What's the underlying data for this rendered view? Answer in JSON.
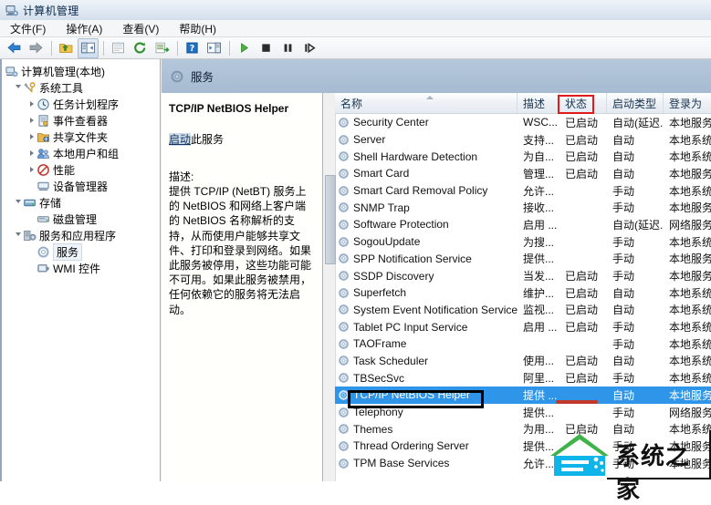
{
  "window": {
    "title": "计算机管理",
    "icon": "computer-management-icon"
  },
  "menu": {
    "items": [
      {
        "label": "文件(F)",
        "name": "menu-file"
      },
      {
        "label": "操作(A)",
        "name": "menu-action"
      },
      {
        "label": "查看(V)",
        "name": "menu-view"
      },
      {
        "label": "帮助(H)",
        "name": "menu-help"
      }
    ]
  },
  "toolbar": {
    "buttons": [
      {
        "name": "back-icon",
        "glyph": "back-arrow"
      },
      {
        "name": "forward-icon",
        "glyph": "forward-arrow"
      },
      {
        "name": "up-folder-icon",
        "glyph": "up-folder"
      },
      {
        "name": "show-hide-console-tree-icon",
        "glyph": "console-tree"
      },
      {
        "name": "properties-icon",
        "glyph": "properties"
      },
      {
        "name": "refresh-icon",
        "glyph": "refresh"
      },
      {
        "name": "export-list-icon",
        "glyph": "export-list"
      },
      {
        "name": "help-icon",
        "glyph": "question-mark"
      },
      {
        "name": "show-action-pane-icon",
        "glyph": "action-pane"
      },
      {
        "name": "start-service-icon",
        "glyph": "play"
      },
      {
        "name": "stop-service-icon",
        "glyph": "stop"
      },
      {
        "name": "pause-service-icon",
        "glyph": "pause"
      },
      {
        "name": "restart-service-icon",
        "glyph": "restart"
      }
    ]
  },
  "tree": {
    "root": {
      "label": "计算机管理(本地)",
      "icon": "computer-icon"
    },
    "items": [
      {
        "label": "系统工具",
        "icon": "system-tools-icon",
        "depth": 1,
        "expander": "open",
        "name": "sidebar-item-system-tools"
      },
      {
        "label": "任务计划程序",
        "icon": "task-scheduler-icon",
        "depth": 2,
        "expander": "closed",
        "name": "sidebar-item-task-scheduler"
      },
      {
        "label": "事件查看器",
        "icon": "event-viewer-icon",
        "depth": 2,
        "expander": "closed",
        "name": "sidebar-item-event-viewer"
      },
      {
        "label": "共享文件夹",
        "icon": "shared-folders-icon",
        "depth": 2,
        "expander": "closed",
        "name": "sidebar-item-shared-folders"
      },
      {
        "label": "本地用户和组",
        "icon": "local-users-groups-icon",
        "depth": 2,
        "expander": "closed",
        "name": "sidebar-item-local-users-groups"
      },
      {
        "label": "性能",
        "icon": "performance-icon",
        "depth": 2,
        "expander": "closed",
        "name": "sidebar-item-performance"
      },
      {
        "label": "设备管理器",
        "icon": "device-manager-icon",
        "depth": 2,
        "expander": "none",
        "name": "sidebar-item-device-manager"
      },
      {
        "label": "存储",
        "icon": "storage-icon",
        "depth": 1,
        "expander": "open",
        "name": "sidebar-item-storage"
      },
      {
        "label": "磁盘管理",
        "icon": "disk-management-icon",
        "depth": 2,
        "expander": "none",
        "name": "sidebar-item-disk-management"
      },
      {
        "label": "服务和应用程序",
        "icon": "services-applications-icon",
        "depth": 1,
        "expander": "open",
        "name": "sidebar-item-services-applications"
      },
      {
        "label": "服务",
        "icon": "services-icon",
        "depth": 2,
        "expander": "none",
        "selected": true,
        "name": "sidebar-item-services"
      },
      {
        "label": "WMI 控件",
        "icon": "wmi-control-icon",
        "depth": 2,
        "expander": "none",
        "name": "sidebar-item-wmi-control"
      }
    ]
  },
  "right_header": {
    "title": "服务",
    "icon": "services-icon"
  },
  "detail": {
    "service_name": "TCP/IP NetBIOS Helper",
    "action_link": "启动",
    "action_suffix": "此服务",
    "description_label": "描述:",
    "description": "提供 TCP/IP (NetBT) 服务上的 NetBIOS 和网络上客户端的 NetBIOS 名称解析的支持，从而使用户能够共享文件、打印和登录到网络。如果此服务被停用，这些功能可能不可用。如果此服务被禁用，任何依赖它的服务将无法启动。"
  },
  "list": {
    "columns": [
      {
        "label": "名称",
        "name": "column-header-name",
        "sorted": true
      },
      {
        "label": "描述",
        "name": "column-header-description"
      },
      {
        "label": "状态",
        "name": "column-header-status",
        "highlighted": true
      },
      {
        "label": "启动类型",
        "name": "column-header-startup-type"
      },
      {
        "label": "登录为",
        "name": "column-header-log-on-as"
      }
    ],
    "rows": [
      {
        "name": "Security Center",
        "desc": "WSC...",
        "state": "已启动",
        "start": "自动(延迟...",
        "logon": "本地服务"
      },
      {
        "name": "Server",
        "desc": "支持...",
        "state": "已启动",
        "start": "自动",
        "logon": "本地系统"
      },
      {
        "name": "Shell Hardware Detection",
        "desc": "为自...",
        "state": "已启动",
        "start": "自动",
        "logon": "本地系统"
      },
      {
        "name": "Smart Card",
        "desc": "管理...",
        "state": "已启动",
        "start": "自动",
        "logon": "本地服务"
      },
      {
        "name": "Smart Card Removal Policy",
        "desc": "允许...",
        "state": "",
        "start": "手动",
        "logon": "本地系统"
      },
      {
        "name": "SNMP Trap",
        "desc": "接收...",
        "state": "",
        "start": "手动",
        "logon": "本地服务"
      },
      {
        "name": "Software Protection",
        "desc": "启用 ...",
        "state": "",
        "start": "自动(延迟...",
        "logon": "网络服务"
      },
      {
        "name": "SogouUpdate",
        "desc": "为搜...",
        "state": "",
        "start": "手动",
        "logon": "本地系统"
      },
      {
        "name": "SPP Notification Service",
        "desc": "提供...",
        "state": "",
        "start": "手动",
        "logon": "本地服务"
      },
      {
        "name": "SSDP Discovery",
        "desc": "当发...",
        "state": "已启动",
        "start": "手动",
        "logon": "本地服务"
      },
      {
        "name": "Superfetch",
        "desc": "维护...",
        "state": "已启动",
        "start": "自动",
        "logon": "本地系统"
      },
      {
        "name": "System Event Notification Service",
        "desc": "监视...",
        "state": "已启动",
        "start": "自动",
        "logon": "本地系统"
      },
      {
        "name": "Tablet PC Input Service",
        "desc": "启用 ...",
        "state": "已启动",
        "start": "手动",
        "logon": "本地系统"
      },
      {
        "name": "TAOFrame",
        "desc": "",
        "state": "",
        "start": "手动",
        "logon": "本地系统"
      },
      {
        "name": "Task Scheduler",
        "desc": "使用...",
        "state": "已启动",
        "start": "自动",
        "logon": "本地系统"
      },
      {
        "name": "TBSecSvc",
        "desc": "阿里...",
        "state": "已启动",
        "start": "手动",
        "logon": "本地系统"
      },
      {
        "name": "TCP/IP NetBIOS Helper",
        "desc": "提供 ...",
        "state": "",
        "start": "自动",
        "logon": "本地服务",
        "selected": true
      },
      {
        "name": "Telephony",
        "desc": "提供...",
        "state": "",
        "start": "手动",
        "logon": "网络服务"
      },
      {
        "name": "Themes",
        "desc": "为用...",
        "state": "已启动",
        "start": "自动",
        "logon": "本地系统"
      },
      {
        "name": "Thread Ordering Server",
        "desc": "提供...",
        "state": "",
        "start": "手动",
        "logon": "本地服务"
      },
      {
        "name": "TPM Base Services",
        "desc": "允许...",
        "state": "",
        "start": "手动",
        "logon": "本地服务"
      }
    ]
  },
  "annotations": {
    "status_header_box": {
      "color": "#e01b1b"
    },
    "selected_row_box": {
      "color": "#000000"
    },
    "status_cell_underline": {
      "color": "#c0392b"
    }
  },
  "watermark": {
    "text": "系统之家",
    "logo": "house-logo-icon"
  }
}
